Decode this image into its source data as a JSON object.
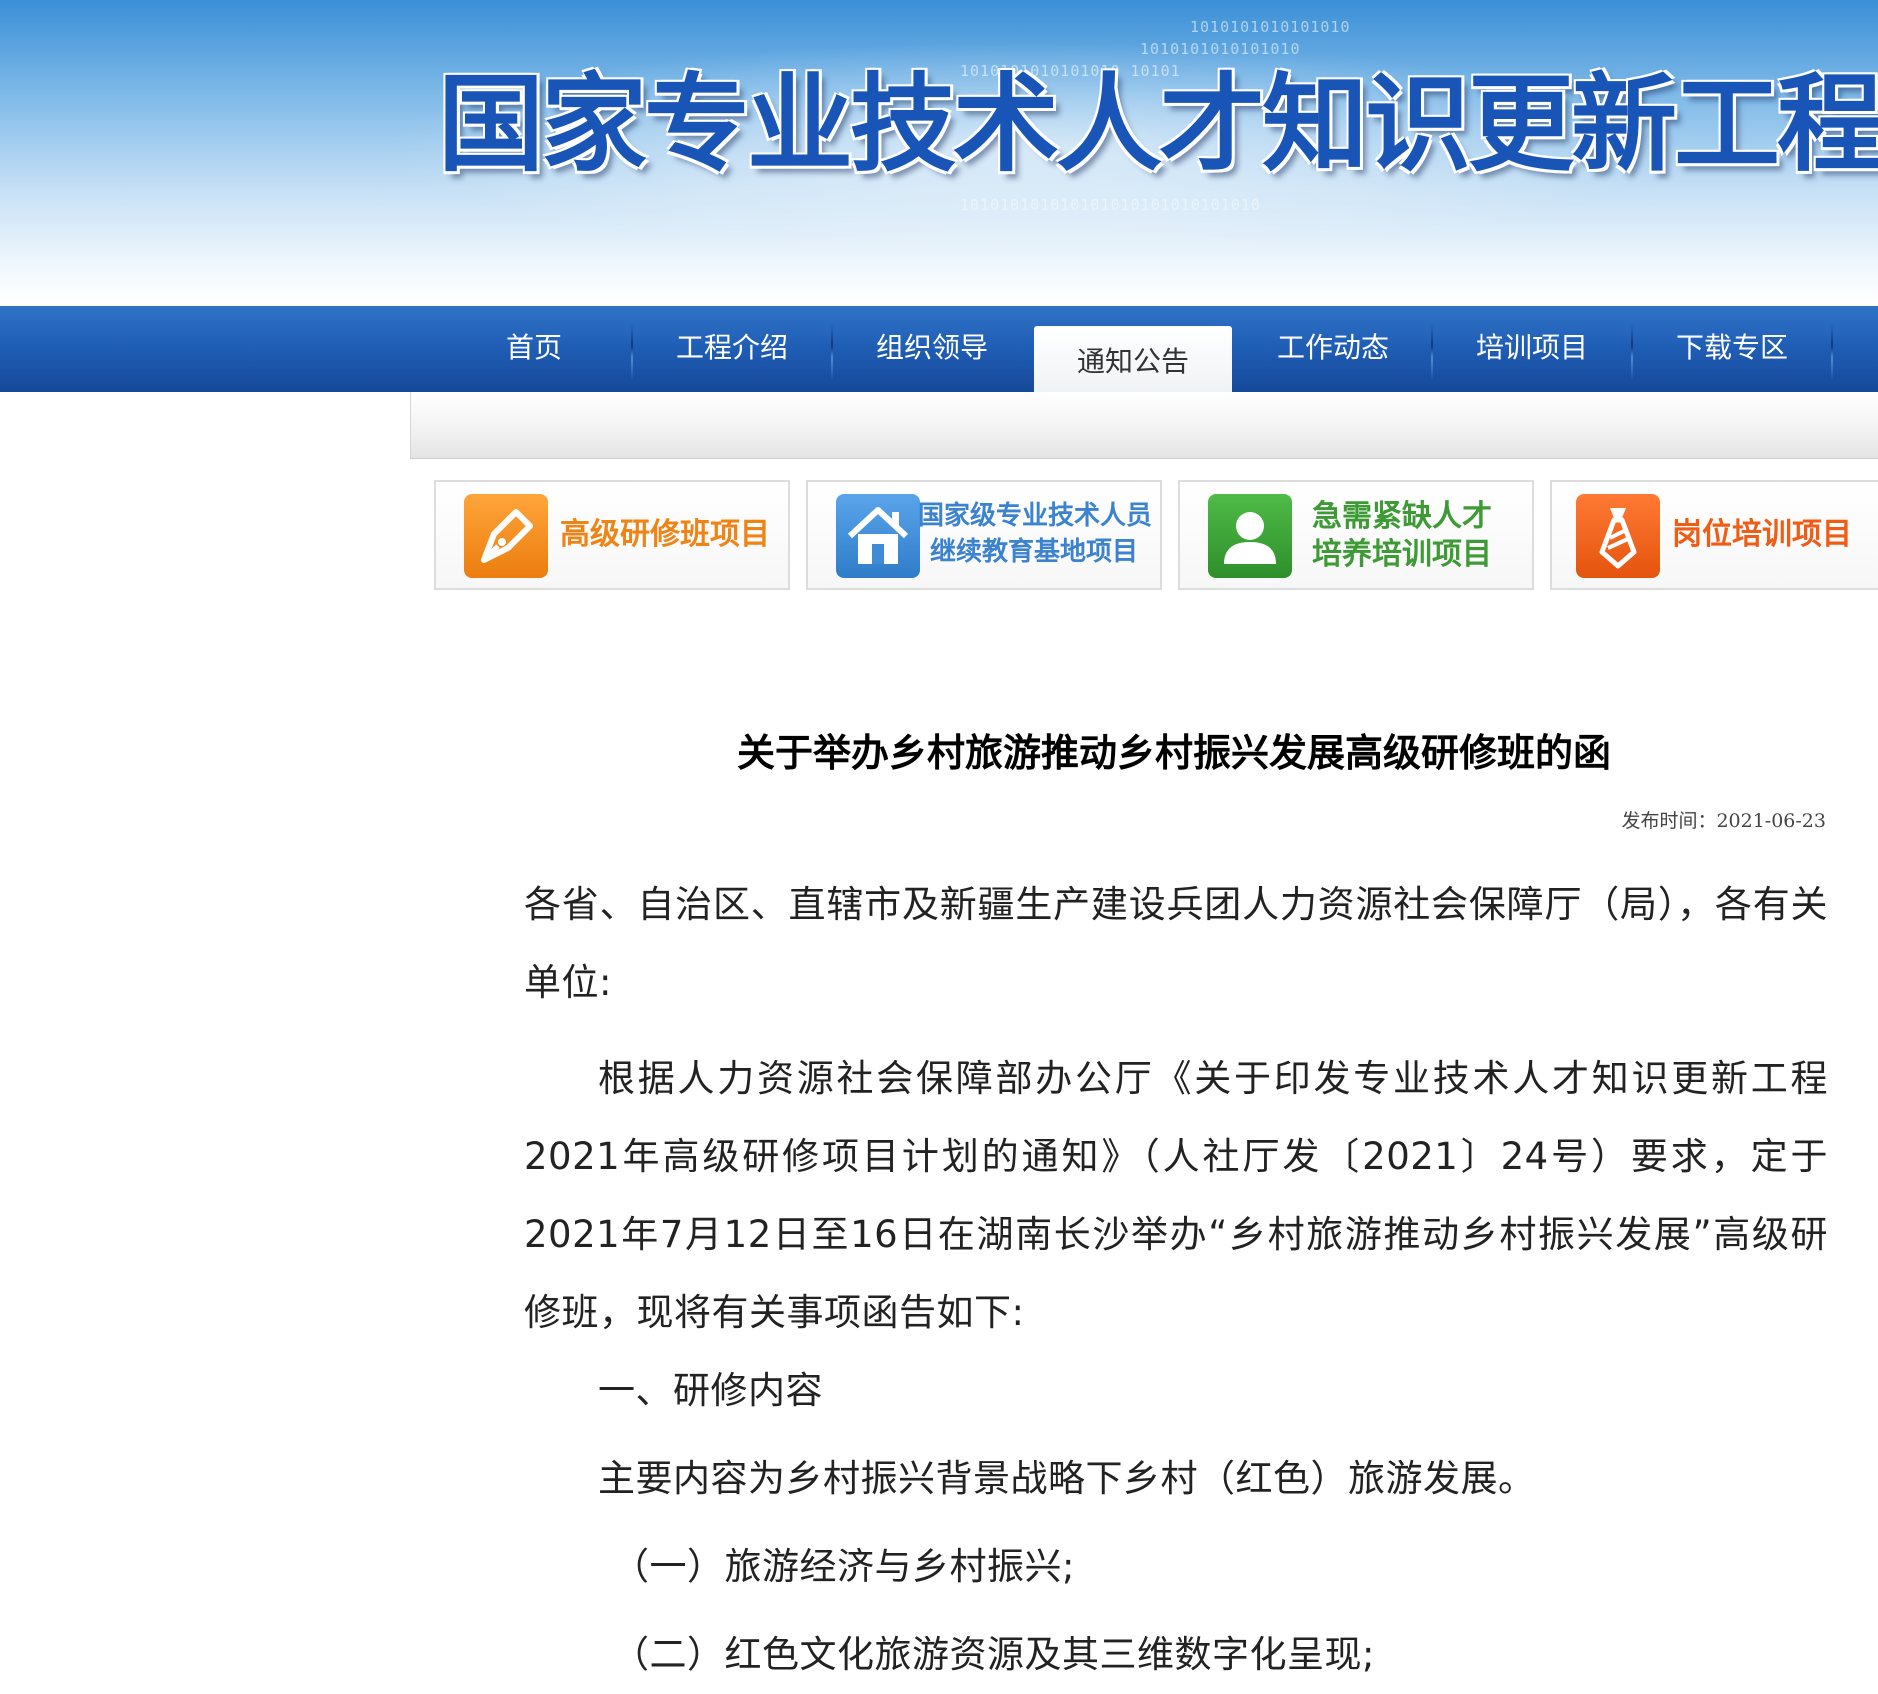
{
  "banner": {
    "site_title": "国家专业技术人才知识更新工程",
    "binary_decor": [
      "1010101010101010",
      "1010101010101010",
      "1010101010101010  10101",
      "101010101010101010101010101010"
    ]
  },
  "nav": {
    "items": [
      {
        "label": "首页"
      },
      {
        "label": "工程介绍"
      },
      {
        "label": "组织领导"
      },
      {
        "label": "通知公告",
        "active": true
      },
      {
        "label": "工作动态"
      },
      {
        "label": "培训项目"
      },
      {
        "label": "下载专区"
      }
    ]
  },
  "projects": [
    {
      "lines": [
        "高级研修班项目"
      ],
      "icon": "pen-icon",
      "color": "#f08a1c"
    },
    {
      "lines": [
        "国家级专业技术人员",
        "继续教育基地项目"
      ],
      "icon": "house-icon",
      "color": "#3f8bd6"
    },
    {
      "lines": [
        "急需紧缺人才",
        "培养培训项目"
      ],
      "icon": "person-icon",
      "color": "#3aa135"
    },
    {
      "lines": [
        "岗位培训项目"
      ],
      "icon": "tie-icon",
      "color": "#f0621a"
    }
  ],
  "article": {
    "title": "关于举办乡村旅游推动乡村振兴发展高级研修班的函",
    "date": "发布时间：2021-06-23",
    "addressee": "各省、自治区、直辖市及新疆生产建设兵团人力资源社会保障厅（局），各有关单位:",
    "intro": "根据人力资源社会保障部办公厅《关于印发专业技术人才知识更新工程2021年高级研修项目计划的通知》（人社厅发〔2021〕24号）要求，定于2021年7月12日至16日在湖南长沙举办“乡村旅游推动乡村振兴发展”高级研修班，现将有关事项函告如下:",
    "section1": "一、研修内容",
    "section1_text": "主要内容为乡村振兴背景战略下乡村（红色）旅游发展。",
    "item1": "（一）旅游经济与乡村振兴;",
    "item2": "（二）红色文化旅游资源及其三维数字化呈现;"
  },
  "colors": {
    "nav_bg": "#1f5db4",
    "title_blue": "#1855b6",
    "accent_orange": "#f08a1c",
    "accent_blue": "#3f8bd6",
    "accent_green": "#3aa135",
    "accent_red_orange": "#f0621a"
  }
}
